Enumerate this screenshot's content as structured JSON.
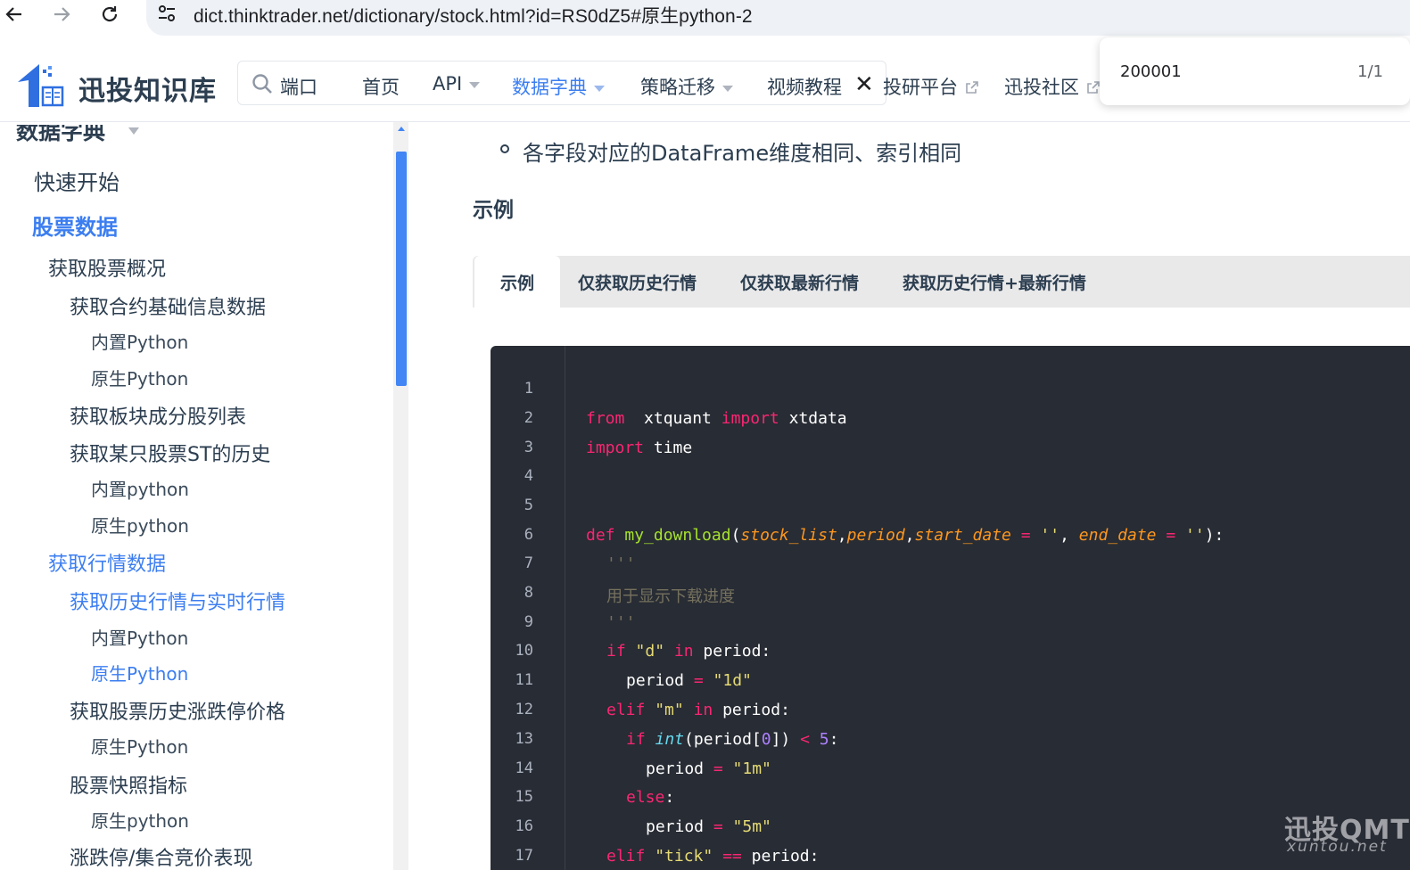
{
  "browser": {
    "url": "dict.thinktrader.net/dictionary/stock.html?id=RS0dZ5#原生python-2"
  },
  "header": {
    "brand": "迅投知识库",
    "search_text": "端口",
    "nav": [
      {
        "label": "首页"
      },
      {
        "label": "API"
      },
      {
        "label": "数据字典"
      },
      {
        "label": "策略迁移"
      },
      {
        "label": "视频教程"
      },
      {
        "label": "投研平台"
      },
      {
        "label": "迅投社区"
      }
    ]
  },
  "find_bar": {
    "query": "200001",
    "count": "1/1"
  },
  "sidebar": {
    "heading": "数据字典",
    "items": [
      {
        "label": "快速开始"
      },
      {
        "label": "股票数据"
      },
      {
        "label": "获取股票概况"
      },
      {
        "label": "获取合约基础信息数据"
      },
      {
        "label": "内置Python"
      },
      {
        "label": "原生Python"
      },
      {
        "label": "获取板块成分股列表"
      },
      {
        "label": "获取某只股票ST的历史"
      },
      {
        "label": "内置python"
      },
      {
        "label": "原生python"
      },
      {
        "label": "获取行情数据"
      },
      {
        "label": "获取历史行情与实时行情"
      },
      {
        "label": "内置Python"
      },
      {
        "label": "原生Python"
      },
      {
        "label": "获取股票历史涨跌停价格"
      },
      {
        "label": "原生Python"
      },
      {
        "label": "股票快照指标"
      },
      {
        "label": "原生python"
      },
      {
        "label": "涨跌停/集合竞价表现"
      }
    ]
  },
  "content": {
    "bullet_text": "各字段对应的DataFrame维度相同、索引相同",
    "section_title": "示例",
    "tabs": [
      {
        "label": "示例"
      },
      {
        "label": "仅获取历史行情"
      },
      {
        "label": "仅获取最新行情"
      },
      {
        "label": "获取历史行情+最新行情"
      }
    ],
    "line_numbers": [
      "1",
      "2",
      "3",
      "4",
      "5",
      "6",
      "7",
      "8",
      "9",
      "10",
      "11",
      "12",
      "13",
      "14",
      "15",
      "16",
      "17"
    ]
  },
  "colors": {
    "accent": "#3c7ef0",
    "code_bg": "#282c34"
  },
  "watermark": {
    "title": "迅投QMT",
    "subtitle": "xuntou.net"
  }
}
